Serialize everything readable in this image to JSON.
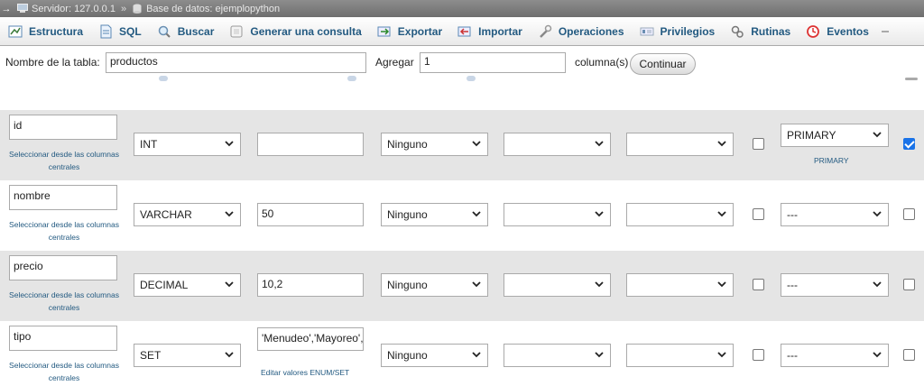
{
  "breadcrumb": {
    "server_label": "Servidor: 127.0.0.1",
    "separator": "»",
    "db_label": "Base de datos: ejemplopython"
  },
  "tabs": [
    {
      "label": "Estructura",
      "icon": "structure-icon"
    },
    {
      "label": "SQL",
      "icon": "sql-icon"
    },
    {
      "label": "Buscar",
      "icon": "search-icon"
    },
    {
      "label": "Generar una consulta",
      "icon": "query-icon"
    },
    {
      "label": "Exportar",
      "icon": "export-icon"
    },
    {
      "label": "Importar",
      "icon": "import-icon"
    },
    {
      "label": "Operaciones",
      "icon": "wrench-icon"
    },
    {
      "label": "Privilegios",
      "icon": "privileges-icon"
    },
    {
      "label": "Rutinas",
      "icon": "routines-icon"
    },
    {
      "label": "Eventos",
      "icon": "clock-icon"
    }
  ],
  "form": {
    "table_name_label": "Nombre de la tabla:",
    "table_name_value": "productos",
    "add_label": "Agregar",
    "add_value": "1",
    "columns_label": "columna(s)",
    "continue_label": "Continuar"
  },
  "central_columns_link": "Seleccionar desde las columnas centrales",
  "edit_enum_link": "Editar valores ENUM/SET",
  "columns": [
    {
      "name": "id",
      "type": "INT",
      "length": "",
      "default": "Ninguno",
      "collation": "",
      "attributes": "",
      "null": false,
      "index": "PRIMARY",
      "index_note": "PRIMARY",
      "ai": true
    },
    {
      "name": "nombre",
      "type": "VARCHAR",
      "length": "50",
      "default": "Ninguno",
      "collation": "",
      "attributes": "",
      "null": false,
      "index": "---",
      "index_note": "",
      "ai": false
    },
    {
      "name": "precio",
      "type": "DECIMAL",
      "length": "10,2",
      "default": "Ninguno",
      "collation": "",
      "attributes": "",
      "null": false,
      "index": "---",
      "index_note": "",
      "ai": false
    },
    {
      "name": "tipo",
      "type": "SET",
      "length": "'Menudeo','Mayoreo',",
      "default": "Ninguno",
      "collation": "",
      "attributes": "",
      "null": false,
      "index": "---",
      "index_note": "",
      "ai": false
    }
  ],
  "colors": {
    "link": "#235a81",
    "row_shade": "#e5e5e5",
    "checkbox_checked": "#1a73e8"
  }
}
